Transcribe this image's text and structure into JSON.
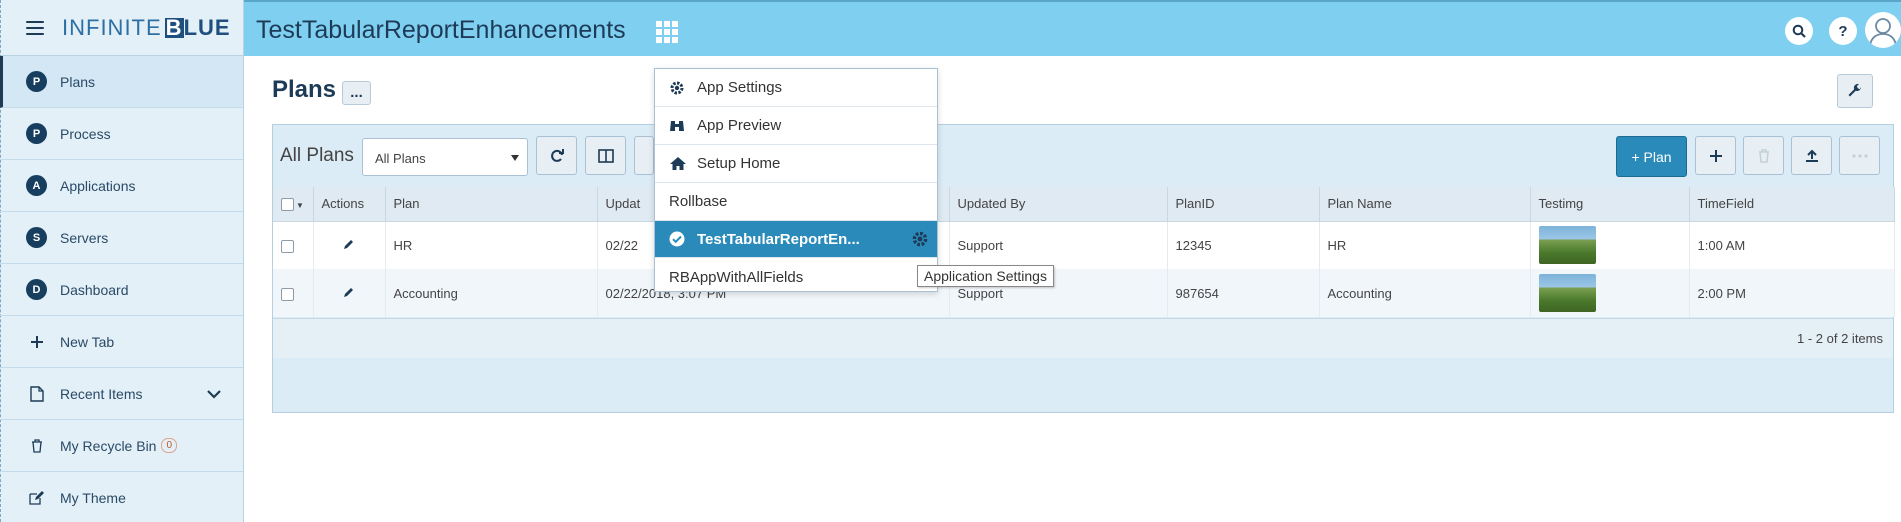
{
  "brand": {
    "logo_part1": "INFINITE",
    "logo_part2": "BLUE",
    "logo_box": "B"
  },
  "sidebar": {
    "items": [
      {
        "badge": "P",
        "label": "Plans"
      },
      {
        "badge": "P",
        "label": "Process"
      },
      {
        "badge": "A",
        "label": "Applications"
      },
      {
        "badge": "S",
        "label": "Servers"
      },
      {
        "badge": "D",
        "label": "Dashboard"
      },
      {
        "icon": "plus-icon",
        "label": "New Tab"
      },
      {
        "icon": "document-icon",
        "label": "Recent Items"
      },
      {
        "icon": "trash-icon",
        "label": "My Recycle Bin",
        "count": "0"
      },
      {
        "icon": "edit-icon",
        "label": "My Theme"
      }
    ]
  },
  "topbar": {
    "title": "TestTabularReportEnhancements",
    "search_icon": "search-icon",
    "help_label": "?"
  },
  "page": {
    "title": "Plans",
    "more_label": "..."
  },
  "toolbar": {
    "view_label": "All Plans",
    "select_value": "All Plans",
    "add_plan_label": "+ Plan"
  },
  "grid": {
    "columns": [
      "Actions",
      "Plan",
      "Updat",
      "Updated By",
      "PlanID",
      "Plan Name",
      "Testimg",
      "TimeField"
    ],
    "rows": [
      {
        "plan": "HR",
        "updated": "02/22",
        "updated_by": "Support",
        "plan_id": "12345",
        "plan_name": "HR",
        "time": "1:00 AM"
      },
      {
        "plan": "Accounting",
        "updated": "02/22/2018, 3:07 PM",
        "updated_by": "Support",
        "plan_id": "987654",
        "plan_name": "Accounting",
        "time": "2:00 PM"
      }
    ],
    "pager": "1 - 2 of 2 items"
  },
  "app_menu": {
    "items": [
      {
        "icon": "gear-icon",
        "label": "App Settings"
      },
      {
        "icon": "binoculars-icon",
        "label": "App Preview"
      },
      {
        "icon": "home-icon",
        "label": "Setup Home"
      },
      {
        "label": "Rollbase"
      },
      {
        "icon": "check-circle-icon",
        "label": "TestTabularReportEn..."
      },
      {
        "label": "RBAppWithAllFields"
      }
    ],
    "tooltip": "Application Settings"
  },
  "colors": {
    "topbar": "#7ecff0",
    "sidebar": "#e3f0f8",
    "accent": "#2a8bbb",
    "badge": "#173e5e"
  }
}
